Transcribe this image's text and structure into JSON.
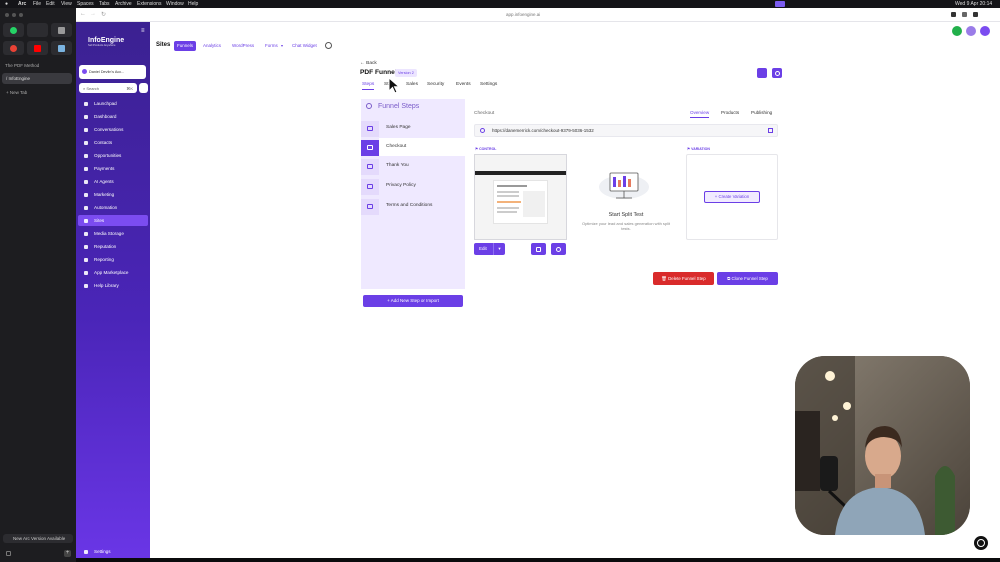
{
  "menubar": {
    "app": "Arc",
    "items": [
      "File",
      "Edit",
      "View",
      "Spaces",
      "Tabs",
      "Archive",
      "Extensions",
      "Window",
      "Help"
    ],
    "clock": "Wed 9 Apr  20:14"
  },
  "arc": {
    "space_title": "The PDF Method",
    "tabs": [
      "/ InfoEngine",
      "+ New Tab"
    ],
    "update_banner": "New Arc Version Available"
  },
  "browser": {
    "url": "app.infoengine.ai"
  },
  "ghl": {
    "logo": "InfoEngine",
    "logo_sub": "Sell Products Anywhere",
    "account": "Daniel Devlin's Acc...",
    "search": "Search",
    "search_shortcut": "⌘K",
    "nav": [
      "Launchpad",
      "Dashboard",
      "Conversations",
      "Contacts",
      "Opportunities",
      "Payments",
      "AI Agents",
      "Marketing",
      "Automation",
      "Sites",
      "Media Storage",
      "Reputation",
      "Reporting",
      "App Marketplace",
      "Help Library"
    ],
    "settings": "Settings"
  },
  "topbar": {
    "title": "Sites",
    "tabs": [
      "Funnels",
      "Analytics",
      "WordPress",
      "Forms",
      "Chat Widget"
    ]
  },
  "funnel": {
    "back": "Back",
    "title": "PDF Funnel",
    "version": "Version 2",
    "tabs": [
      "Steps",
      "Stats",
      "Sales",
      "Security",
      "Events",
      "Settings"
    ]
  },
  "steps": {
    "header": "Funnel Steps",
    "items": [
      "Sales Page",
      "Checkout",
      "Thank You",
      "Privacy Policy",
      "Terms and Conditions"
    ],
    "add_button": "+ Add New Step or Import"
  },
  "detail": {
    "heading": "Checkout",
    "tabs": [
      "Overview",
      "Products",
      "Publishing"
    ],
    "url": "https://danemerrick.com/checkout-9379-5036-1532",
    "control_tag": "CONTROL",
    "variation_tag": "VARIATION",
    "edit": "Edit",
    "split_title": "Start Split Test",
    "split_desc": "Optimize your lead and sales generation with split tests.",
    "create_variation": "+ Create Variation",
    "delete_button": "Delete Funnel Step",
    "clone_button": "Clone Funnel Step"
  },
  "colors": {
    "accent": "#6b3fe6",
    "danger": "#d92b2b",
    "sidebar_top": "#3b2191"
  }
}
